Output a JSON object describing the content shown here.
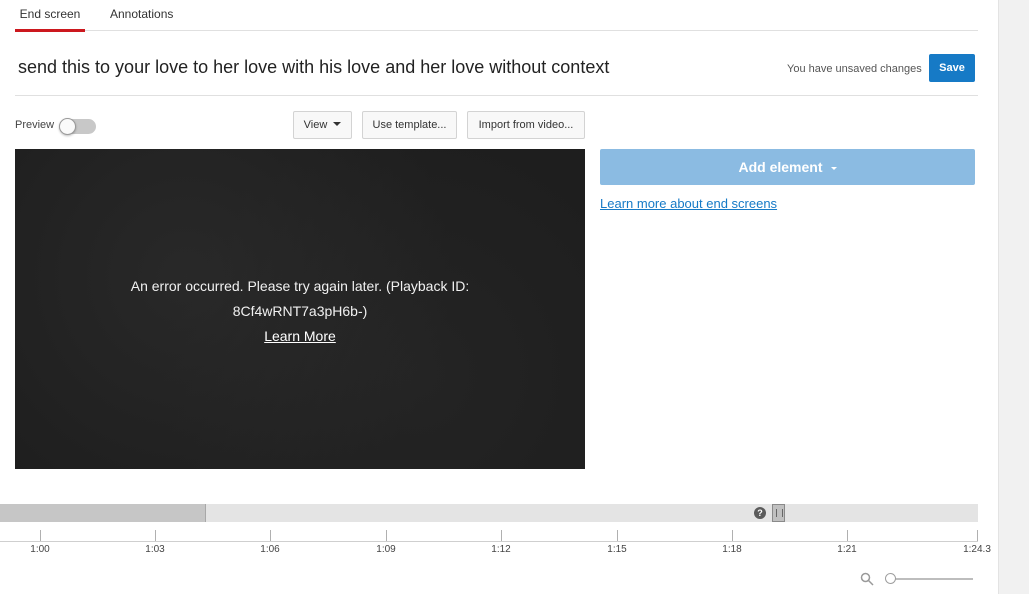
{
  "tabs": [
    {
      "label": "End screen"
    },
    {
      "label": "Annotations"
    }
  ],
  "header": {
    "title": "send this to your love to her love with his love and her love without context",
    "unsaved_text": "You have unsaved changes",
    "save_label": "Save"
  },
  "toolbar": {
    "preview_label": "Preview",
    "preview_on": false,
    "view_label": "View",
    "template_label": "Use template...",
    "import_label": "Import from video..."
  },
  "player": {
    "error_line1": "An error occurred. Please try again later. (Playback ID:",
    "error_line2": "8Cf4wRNT7a3pH6b-)",
    "learn_more": "Learn More"
  },
  "side": {
    "add_element_label": "Add element",
    "learn_link": "Learn more about end screens"
  },
  "timeline": {
    "help_symbol": "?",
    "ticks": [
      "1:00",
      "1:03",
      "1:06",
      "1:09",
      "1:12",
      "1:15",
      "1:18",
      "1:21",
      "1:24.3"
    ]
  },
  "colors": {
    "accent_red": "#cc181e",
    "save_blue": "#167ac6",
    "add_element_blue": "#8bbbe2"
  }
}
